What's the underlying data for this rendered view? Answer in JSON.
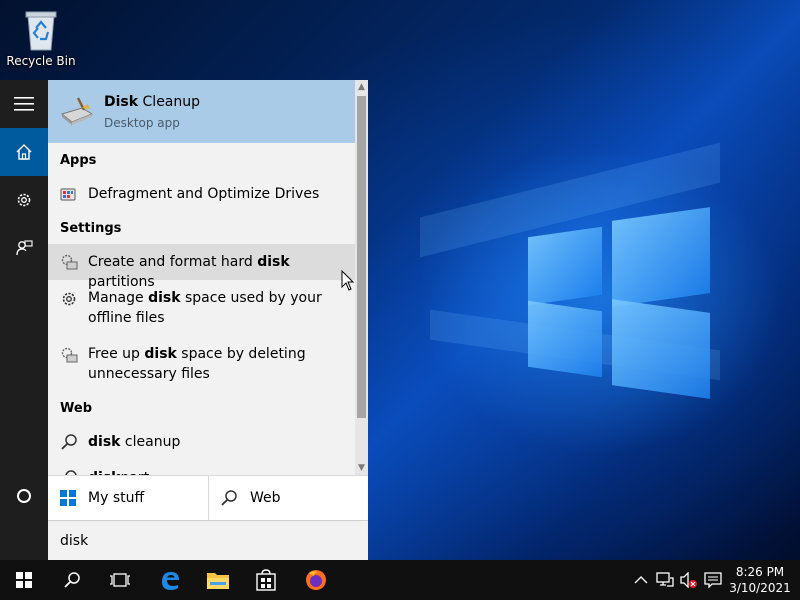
{
  "desktop": {
    "recycle_bin_label": "Recycle Bin"
  },
  "search": {
    "best_match": {
      "title_bold": "Disk",
      "title_rest": " Cleanup",
      "subtitle": "Desktop app",
      "icon": "disk-cleanup-icon"
    },
    "sections": {
      "apps": "Apps",
      "settings": "Settings",
      "web": "Web"
    },
    "apps": [
      {
        "label": "Defragment and Optimize Drives",
        "icon": "defrag-icon"
      }
    ],
    "settings": [
      {
        "pre": "Create and format hard ",
        "bold": "disk",
        "post": " partitions",
        "icon": "partition-settings-icon"
      },
      {
        "pre": "Manage ",
        "bold": "disk",
        "post": " space used by your offline files",
        "icon": "gear-icon"
      },
      {
        "pre": "Free up ",
        "bold": "disk",
        "post": " space by deleting unnecessary files",
        "icon": "storage-settings-icon"
      }
    ],
    "web": [
      {
        "bold": "disk",
        "post": " cleanup",
        "icon": "search-icon"
      },
      {
        "bold": "disk",
        "post": "part",
        "icon": "search-icon"
      }
    ],
    "filters": {
      "my_stuff": "My stuff",
      "web": "Web"
    },
    "query": "disk"
  },
  "taskbar": {
    "time": "8:26 PM",
    "date": "3/10/2021",
    "pinned": [
      "task-view",
      "edge",
      "file-explorer",
      "store",
      "firefox"
    ]
  },
  "colors": {
    "accent": "#005a9e",
    "best_match_bg": "#a9cbe7",
    "hover_bg": "#dcdcdc"
  }
}
